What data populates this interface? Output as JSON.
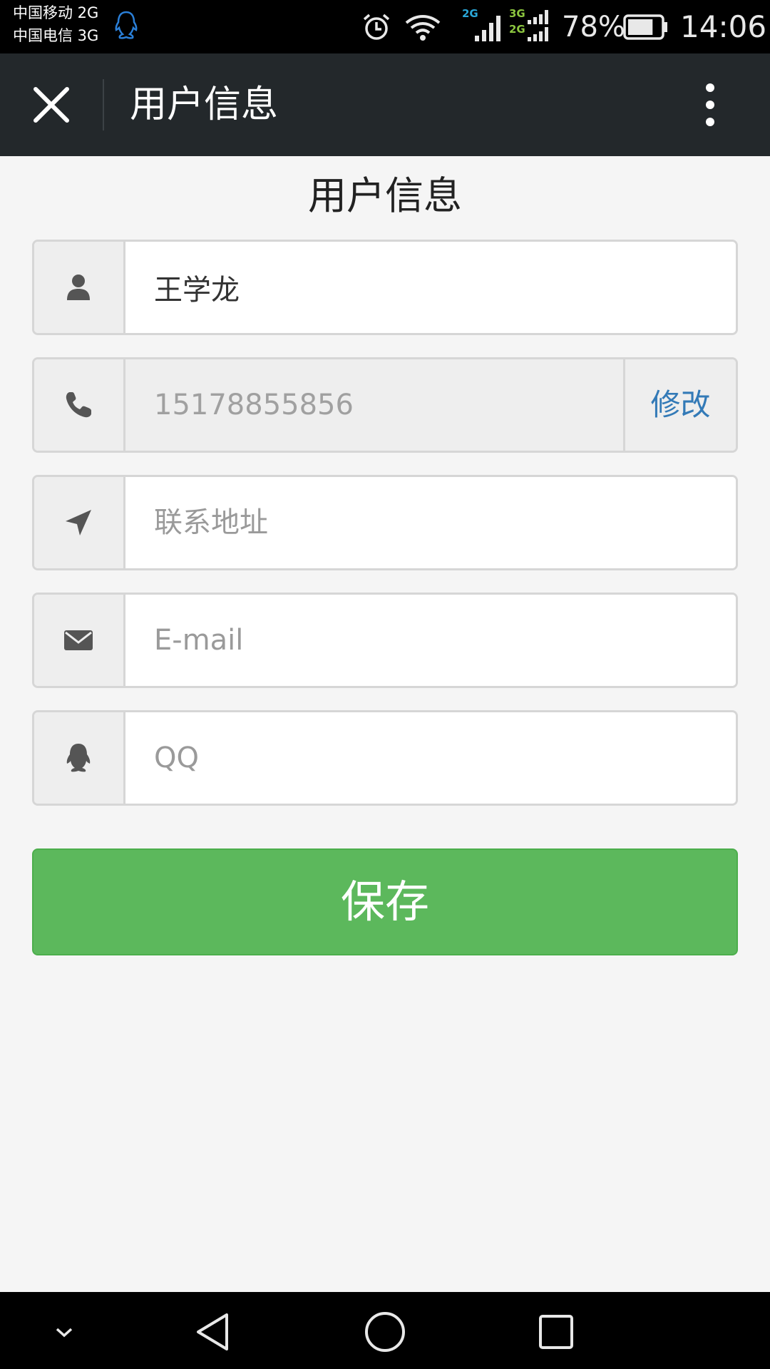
{
  "status_bar": {
    "carrier_1": "中国移动 2G",
    "carrier_2": "中国电信 3G",
    "network_1": "2G",
    "network_2a": "3G",
    "network_2b": "2G",
    "battery_percent": "78%",
    "battery_level": 0.78,
    "time": "14:06",
    "icons": [
      "qq-icon",
      "alarm-icon",
      "wifi-icon",
      "signal-icon",
      "battery-icon"
    ]
  },
  "toolbar": {
    "title": "用户信息",
    "close_icon": "close-icon",
    "more_icon": "more-vertical-icon"
  },
  "page": {
    "title": "用户信息"
  },
  "form": {
    "name": {
      "icon": "user-icon",
      "value": "王学龙",
      "placeholder": ""
    },
    "phone": {
      "icon": "phone-icon",
      "value": "15178855856",
      "edit_label": "修改"
    },
    "address": {
      "icon": "location-arrow-icon",
      "value": "",
      "placeholder": "联系地址"
    },
    "email": {
      "icon": "envelope-icon",
      "value": "",
      "placeholder": "E-mail"
    },
    "qq": {
      "icon": "qq-icon",
      "value": "",
      "placeholder": "QQ"
    },
    "save_label": "保存"
  },
  "colors": {
    "toolbar_bg": "#23282b",
    "save_button": "#5cb85c",
    "link_blue": "#337ab7",
    "network_2g": "#2aa7d8",
    "network_3g": "#8cc63f"
  },
  "nav_bar": {
    "icons": [
      "chevron-down-icon",
      "back-triangle-icon",
      "home-circle-icon",
      "recent-square-icon"
    ]
  }
}
